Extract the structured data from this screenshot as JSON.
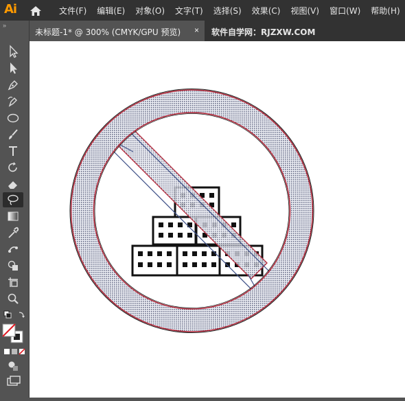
{
  "app": {
    "logo": "Ai"
  },
  "menu": [
    "文件(F)",
    "编辑(E)",
    "对象(O)",
    "文字(T)",
    "选择(S)",
    "效果(C)",
    "视图(V)",
    "窗口(W)",
    "帮助(H)"
  ],
  "tabs": {
    "active": "未标题-1* @ 300% (CMYK/GPU 预览)",
    "close": "×",
    "second": "软件自学网：RJZXW.COM"
  },
  "toolbar": {
    "collapse": "»",
    "tools": [
      "selection-tool",
      "direct-selection-tool",
      "pen-tool",
      "curvature-tool",
      "ellipse-tool",
      "paintbrush-tool",
      "type-tool",
      "rotate-tool",
      "eraser-tool",
      "lasso-tool",
      "gradient-tool",
      "eyedropper-tool",
      "puppet-warp-tool",
      "shape-builder-tool",
      "artboard-tool",
      "zoom-tool"
    ]
  },
  "colors": {
    "stroke_red": "#B22234",
    "fill_pattern": "#6b6f8a",
    "guide_blue": "#3b4e86",
    "menu_bg": "#323232",
    "panel_bg": "#535353",
    "logo": "#FF9A00"
  }
}
